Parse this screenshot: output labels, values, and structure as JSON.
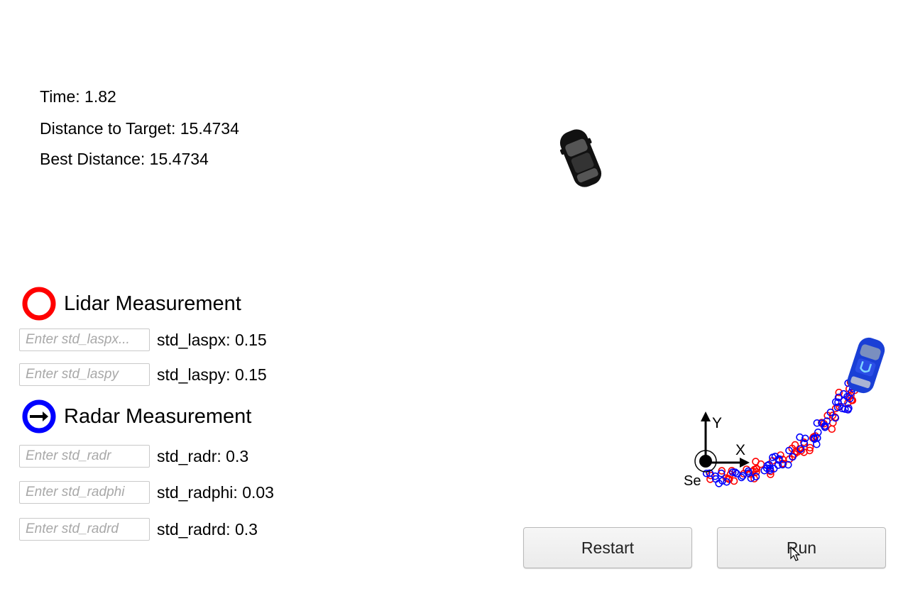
{
  "stats": {
    "time": "Time: 1.82",
    "distance": "Distance to Target: 15.4734",
    "best": "Best Distance: 15.4734"
  },
  "legend": {
    "lidar_label": "Lidar Measurement",
    "lidar_color": "#ff0000",
    "radar_label": "Radar Measurement",
    "radar_color": "#0000ff"
  },
  "params": [
    {
      "placeholder": "Enter std_laspx...",
      "value": "std_laspx: 0.15"
    },
    {
      "placeholder": "Enter std_laspy",
      "value": "std_laspy: 0.15"
    },
    {
      "placeholder": "Enter std_radr",
      "value": "std_radr: 0.3"
    },
    {
      "placeholder": "Enter std_radphi",
      "value": "std_radphi: 0.03"
    },
    {
      "placeholder": "Enter std_radrd",
      "value": "std_radrd: 0.3"
    }
  ],
  "axes": {
    "x_label": "X",
    "y_label": "Y",
    "origin_label": "Se"
  },
  "buttons": {
    "restart": "Restart",
    "run": "Run"
  },
  "colors": {
    "target_car": "#222222",
    "ego_car": "#1a3fd6"
  },
  "icons": [
    "lidar-circle-icon",
    "radar-arrow-icon",
    "cursor-pointer-icon"
  ]
}
